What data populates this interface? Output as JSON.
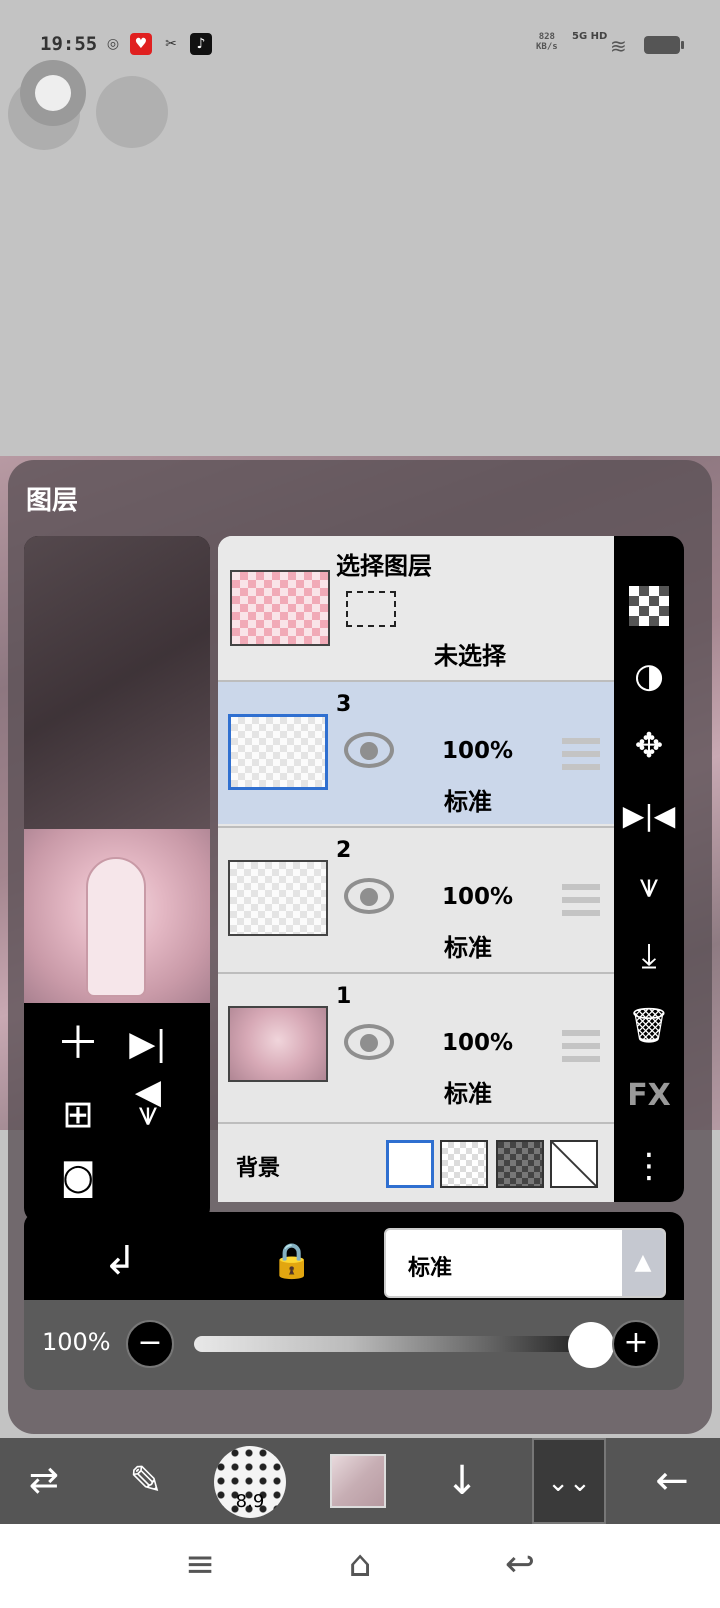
{
  "status_bar": {
    "time": "19:55",
    "net_speed_value": "828",
    "net_speed_unit": "KB/s",
    "signal": "5G HD"
  },
  "layers_panel": {
    "title": "图层",
    "selection": {
      "title": "选择图层",
      "status": "未选择"
    },
    "layers": [
      {
        "number": "3",
        "opacity": "100%",
        "blend": "标准",
        "active": true
      },
      {
        "number": "2",
        "opacity": "100%",
        "blend": "标准",
        "active": false
      },
      {
        "number": "1",
        "opacity": "100%",
        "blend": "标准",
        "active": false
      }
    ],
    "background_label": "背景",
    "side_fx": "FX",
    "blend_mode": "标准",
    "opacity_label": "100%",
    "opacity_value": 1.0
  },
  "toolbar": {
    "brush_size": "8.9"
  },
  "colors": {
    "active_layer": "#cbd7ea",
    "accent": "#2f6fd0",
    "panel": "#000000"
  }
}
